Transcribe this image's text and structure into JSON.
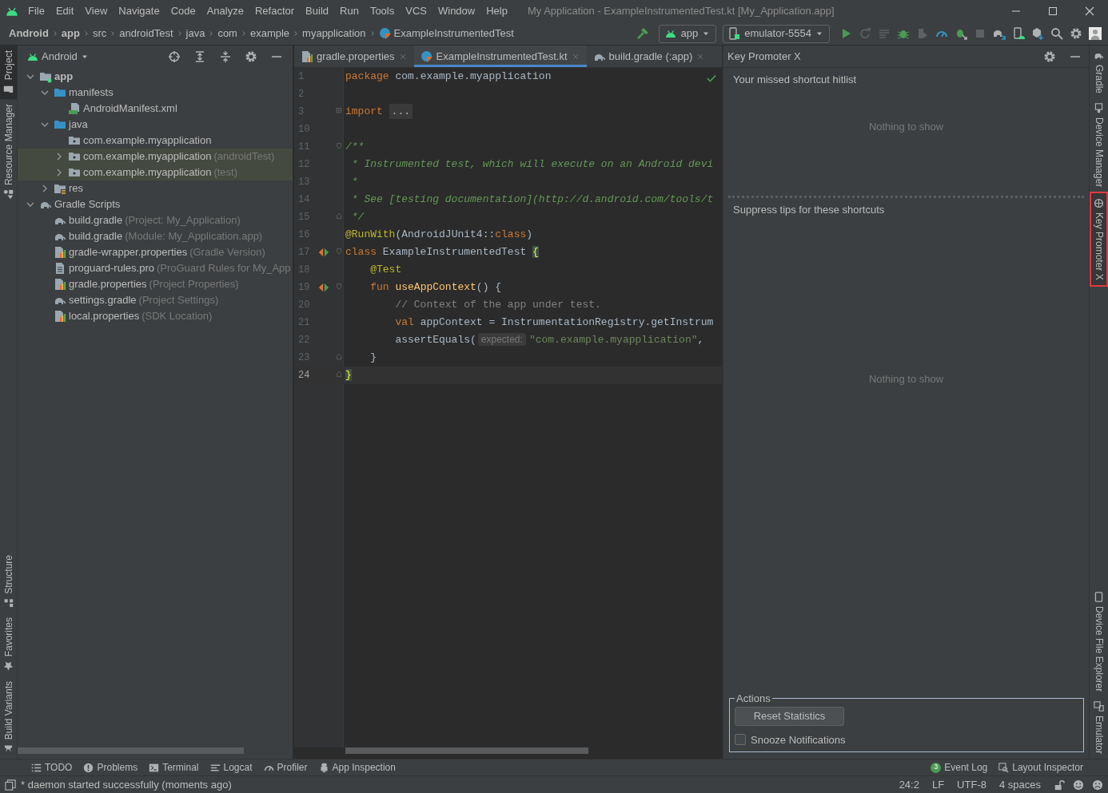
{
  "menu_bar": {
    "items": [
      "File",
      "Edit",
      "View",
      "Navigate",
      "Code",
      "Analyze",
      "Refactor",
      "Build",
      "Run",
      "Tools",
      "VCS",
      "Window",
      "Help"
    ]
  },
  "window": {
    "title": "My Application - ExampleInstrumentedTest.kt [My_Application.app]"
  },
  "breadcrumbs": [
    {
      "label": "Android",
      "bold": true
    },
    {
      "label": "app",
      "bold": true
    },
    {
      "label": "src",
      "bold": false
    },
    {
      "label": "androidTest",
      "bold": false
    },
    {
      "label": "java",
      "bold": false
    },
    {
      "label": "com",
      "bold": false
    },
    {
      "label": "example",
      "bold": false
    },
    {
      "label": "myapplication",
      "bold": false
    },
    {
      "label": "ExampleInstrumentedTest",
      "bold": false
    }
  ],
  "toolbar": {
    "run_config": "app",
    "device": "emulator-5554"
  },
  "left_stripe": {
    "top": [
      {
        "label": "Project",
        "selected": true
      },
      {
        "label": "Resource Manager",
        "selected": false
      }
    ],
    "bottom": [
      {
        "label": "Structure",
        "selected": false
      },
      {
        "label": "Favorites",
        "selected": false
      },
      {
        "label": "Build Variants",
        "selected": false
      }
    ]
  },
  "project_panel": {
    "view": "Android",
    "tree": [
      {
        "label": "app",
        "kind": "module",
        "expanded": true,
        "highlighted": false,
        "children": [
          {
            "label": "manifests",
            "kind": "folder",
            "expanded": true,
            "highlighted": false,
            "children": [
              {
                "label": "AndroidManifest.xml",
                "kind": "manifest",
                "highlighted": false
              }
            ]
          },
          {
            "label": "java",
            "kind": "folder",
            "expanded": true,
            "highlighted": false,
            "children": [
              {
                "label": "com.example.myapplication",
                "kind": "package",
                "highlighted": false
              },
              {
                "label": "com.example.myapplication",
                "hint": "(androidTest)",
                "kind": "package",
                "expanded": false,
                "highlighted": true
              },
              {
                "label": "com.example.myapplication",
                "hint": "(test)",
                "kind": "package",
                "expanded": false,
                "highlighted": true
              }
            ]
          },
          {
            "label": "res",
            "kind": "res",
            "expanded": false,
            "highlighted": false
          }
        ]
      },
      {
        "label": "Gradle Scripts",
        "kind": "gradle",
        "expanded": true,
        "highlighted": false,
        "children": [
          {
            "label": "build.gradle",
            "hint": "(Project: My_Application)",
            "kind": "gradle",
            "highlighted": false
          },
          {
            "label": "build.gradle",
            "hint": "(Module: My_Application.app)",
            "kind": "gradle",
            "highlighted": false
          },
          {
            "label": "gradle-wrapper.properties",
            "hint": "(Gradle Version)",
            "kind": "properties",
            "highlighted": false
          },
          {
            "label": "proguard-rules.pro",
            "hint": "(ProGuard Rules for My_App",
            "kind": "text",
            "highlighted": false
          },
          {
            "label": "gradle.properties",
            "hint": "(Project Properties)",
            "kind": "properties",
            "highlighted": false
          },
          {
            "label": "settings.gradle",
            "hint": "(Project Settings)",
            "kind": "gradle",
            "highlighted": false
          },
          {
            "label": "local.properties",
            "hint": "(SDK Location)",
            "kind": "properties",
            "highlighted": false
          }
        ]
      }
    ]
  },
  "editor": {
    "tabs": [
      {
        "label": "gradle.properties",
        "kind": "properties",
        "selected": false
      },
      {
        "label": "ExampleInstrumentedTest.kt",
        "kind": "class",
        "selected": true
      },
      {
        "label": "build.gradle (:app)",
        "kind": "gradle",
        "selected": false
      }
    ],
    "lines": [
      {
        "number": "1",
        "run": false,
        "current": false,
        "tokens": [
          {
            "kind": "kw",
            "text": "package "
          },
          {
            "kind": "id",
            "text": "com.example.myapplication"
          }
        ]
      },
      {
        "number": "2",
        "run": false,
        "current": false
      },
      {
        "number": "3",
        "run": false,
        "current": false,
        "fold": {
          "kind": "collapsed"
        },
        "tokens": [
          {
            "kind": "kw",
            "text": "import "
          },
          {
            "kind": "folded",
            "text": "..."
          }
        ]
      },
      {
        "number": "10",
        "run": false,
        "current": false
      },
      {
        "number": "11",
        "run": false,
        "current": false,
        "fold": {
          "kind": "start"
        },
        "tokens": [
          {
            "kind": "doc",
            "text": "/**"
          }
        ]
      },
      {
        "number": "12",
        "run": false,
        "current": false,
        "tokens": [
          {
            "kind": "doc",
            "text": " * Instrumented test, which will execute on an Android devi"
          }
        ]
      },
      {
        "number": "13",
        "run": false,
        "current": false,
        "tokens": [
          {
            "kind": "doc",
            "text": " *"
          }
        ]
      },
      {
        "number": "14",
        "run": false,
        "current": false,
        "tokens": [
          {
            "kind": "doc",
            "text": " * See [testing documentation](http://d.android.com/tools/t"
          }
        ]
      },
      {
        "number": "15",
        "run": false,
        "current": false,
        "fold": {
          "kind": "end"
        },
        "tokens": [
          {
            "kind": "doc",
            "text": " */"
          }
        ]
      },
      {
        "number": "16",
        "run": false,
        "current": false,
        "tokens": [
          {
            "kind": "ann",
            "text": "@RunWith"
          },
          {
            "kind": "id",
            "text": "(AndroidJUnit4::"
          },
          {
            "kind": "kw",
            "text": "class"
          },
          {
            "kind": "id",
            "text": ")"
          }
        ]
      },
      {
        "number": "17",
        "run": true,
        "current": false,
        "fold": {
          "kind": "start"
        },
        "tokens": [
          {
            "kind": "kw",
            "text": "class "
          },
          {
            "kind": "id",
            "text": "ExampleInstrumentedTest "
          },
          {
            "kind": "brace",
            "text": "{"
          }
        ]
      },
      {
        "number": "18",
        "run": false,
        "current": false,
        "tokens": [
          {
            "kind": "ann",
            "text": "    @Test"
          }
        ]
      },
      {
        "number": "19",
        "run": true,
        "current": false,
        "fold": {
          "kind": "start"
        },
        "tokens": [
          {
            "kind": "kw",
            "text": "    fun "
          },
          {
            "kind": "fn",
            "text": "useAppContext"
          },
          {
            "kind": "id",
            "text": "() {"
          }
        ]
      },
      {
        "number": "20",
        "run": false,
        "current": false,
        "tokens": [
          {
            "kind": "cmt",
            "text": "        // Context of the app under test."
          }
        ]
      },
      {
        "number": "21",
        "run": false,
        "current": false,
        "tokens": [
          {
            "kind": "kw",
            "text": "        val "
          },
          {
            "kind": "id",
            "text": "appContext = InstrumentationRegistry.getInstrum"
          }
        ]
      },
      {
        "number": "22",
        "run": false,
        "current": false,
        "tokens": [
          {
            "kind": "id",
            "text": "        assertEquals("
          },
          {
            "kind": "hint",
            "text": "expected:"
          },
          {
            "kind": "str",
            "text": "\"com.example.myapplication\""
          },
          {
            "kind": "id",
            "text": ","
          }
        ]
      },
      {
        "number": "23",
        "run": false,
        "current": false,
        "fold": {
          "kind": "end"
        },
        "tokens": [
          {
            "kind": "id",
            "text": "    }"
          }
        ]
      },
      {
        "number": "24",
        "run": false,
        "current": true,
        "fold": {
          "kind": "end"
        },
        "tokens": [
          {
            "kind": "brace",
            "text": "}"
          }
        ]
      }
    ]
  },
  "key_promoter": {
    "title": "Key Promoter X",
    "hitlist_title": "Your missed shortcut hitlist",
    "hitlist_empty": "Nothing to show",
    "suppress_title": "Suppress tips for these shortcuts",
    "suppress_empty": "Nothing to show",
    "actions_title": "Actions",
    "reset_button": "Reset Statistics",
    "snooze": {
      "label": "Snooze Notifications",
      "checked": false
    }
  },
  "right_stripe": {
    "top": [
      {
        "label": "Gradle",
        "selected": false
      },
      {
        "label": "Device Manager",
        "selected": false
      },
      {
        "label": "Key Promoter X",
        "selected": true
      }
    ],
    "bottom": [
      {
        "label": "Device File Explorer",
        "selected": false
      },
      {
        "label": "Emulator",
        "selected": false
      }
    ]
  },
  "tool_windows": [
    {
      "label": "TODO"
    },
    {
      "label": "Problems"
    },
    {
      "label": "Terminal"
    },
    {
      "label": "Logcat"
    },
    {
      "label": "Profiler"
    },
    {
      "label": "App Inspection"
    }
  ],
  "tool_windows_right": [
    {
      "label": "Event Log",
      "badge": "3"
    },
    {
      "label": "Layout Inspector"
    }
  ],
  "status_bar": {
    "message": "* daemon started successfully (moments ago)",
    "items": [
      "24:2",
      "LF",
      "UTF-8",
      "4 spaces"
    ]
  }
}
